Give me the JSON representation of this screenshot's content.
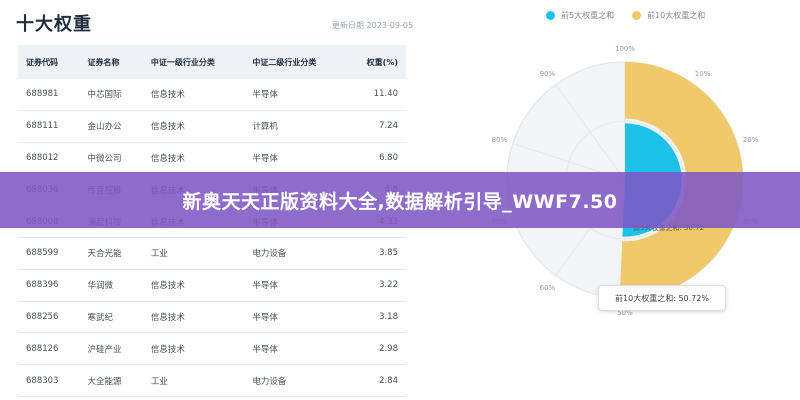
{
  "header": {
    "title": "十大权重",
    "update_time": "更新日期 2023-09-05"
  },
  "legend": [
    {
      "label": "前5大权重之和",
      "color": "#1cc1e8"
    },
    {
      "label": "前10大权重之和",
      "color": "#f0c96a"
    }
  ],
  "table": {
    "columns": [
      "证券代码",
      "证券名称",
      "中证一级行业分类",
      "中证二级行业分类",
      "权重(%)"
    ],
    "rows": [
      [
        "688981",
        "中芯国际",
        "信息技术",
        "半导体",
        "11.40"
      ],
      [
        "688111",
        "金山办公",
        "信息技术",
        "计算机",
        "7.24"
      ],
      [
        "688012",
        "中微公司",
        "信息技术",
        "半导体",
        "6.80"
      ],
      [
        "688036",
        "传音控股",
        "信息技术",
        "半导体",
        "4.8"
      ],
      [
        "688008",
        "澜起科技",
        "信息技术",
        "半导体",
        "4.33"
      ],
      [
        "688599",
        "天合光能",
        "工业",
        "电力设备",
        "3.85"
      ],
      [
        "688396",
        "华润微",
        "信息技术",
        "半导体",
        "3.22"
      ],
      [
        "688256",
        "寒武纪",
        "信息技术",
        "半导体",
        "3.18"
      ],
      [
        "688126",
        "沪硅产业",
        "信息技术",
        "半导体",
        "2.98"
      ],
      [
        "688303",
        "大全能源",
        "工业",
        "电力设备",
        "2.84"
      ]
    ]
  },
  "banner": {
    "text": "新奥天天正版资料大全,数据解析引导_WWF7.50"
  },
  "chart_data": {
    "type": "pie",
    "subtype": "polar-radial-bar",
    "series": [
      {
        "name": "前5大权重之和",
        "value": 50.72,
        "color": "#1cc1e8"
      },
      {
        "name": "前10大权重之和",
        "value": 50.72,
        "color": "#f0c96a"
      }
    ],
    "angle_ticks": [
      "100%",
      "10%",
      "20%",
      "30%",
      "40%",
      "50%",
      "60%",
      "70%",
      "80%",
      "90%"
    ],
    "inner_label": "前5大权重之和: 50.72",
    "tooltip": "前10大权重之和: 50.72%"
  }
}
